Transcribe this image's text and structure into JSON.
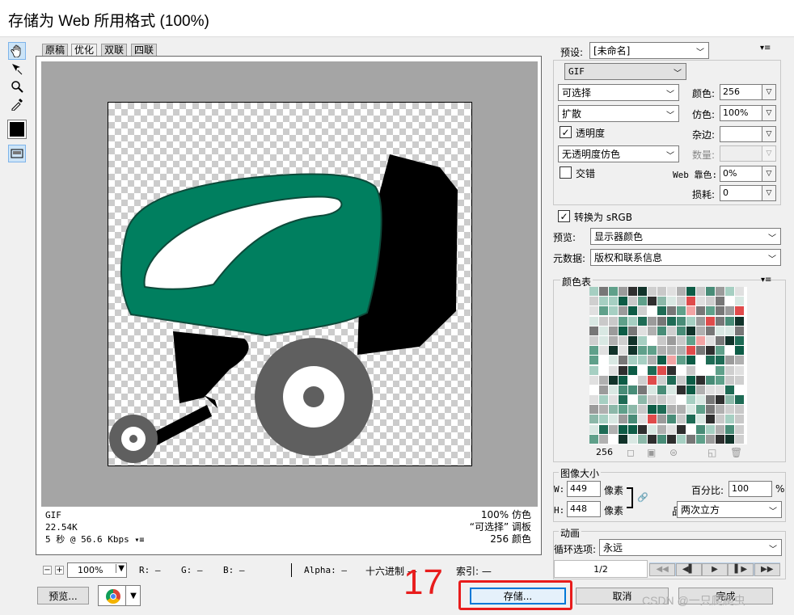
{
  "title": "存储为 Web 所用格式 (100%)",
  "tabs": [
    "原稿",
    "优化",
    "双联",
    "四联"
  ],
  "active_tab": 1,
  "info_left": [
    "GIF",
    "22.54K",
    "5 秒 @ 56.6 Kbps"
  ],
  "info_right": [
    "100% 仿色",
    "“可选择” 调板",
    "256 颜色"
  ],
  "statusbar": {
    "zoom": "100%",
    "r": "R: —",
    "g": "G: —",
    "b": "B: —",
    "alpha": "Alpha: —",
    "hex": "十六进制 —",
    "index": "索引: —"
  },
  "bottom": {
    "preview": "预览...",
    "save": "存储...",
    "cancel": "取消",
    "done": "完成",
    "annotation": "17",
    "watermark": "CSDN @一只爬爬虫"
  },
  "settings": {
    "preset_label": "预设:",
    "preset_value": "[未命名]",
    "format": "GIF",
    "reduction": "可选择",
    "dither_algo": "扩散",
    "colors_label": "颜色:",
    "colors_value": "256",
    "dither_label": "仿色:",
    "dither_value": "100%",
    "transparency": "透明度",
    "matte_label": "杂边:",
    "matte_value": "",
    "trans_dither": "无透明度仿色",
    "amount_label": "数量:",
    "amount_value": "",
    "interlaced": "交错",
    "websnap_label": "Web 靠色:",
    "websnap_value": "0%",
    "lossy_label": "损耗:",
    "lossy_value": "0",
    "srgb": "转换为 sRGB",
    "preview_label": "预览:",
    "preview_value": "显示器颜色",
    "meta_label": "元数据:",
    "meta_value": "版权和联系信息"
  },
  "color_table": {
    "title": "颜色表",
    "count": "256"
  },
  "image_size": {
    "title": "图像大小",
    "w_label": "W:",
    "w_value": "449",
    "h_label": "H:",
    "h_value": "448",
    "unit": "像素",
    "percent_label": "百分比:",
    "percent_value": "100",
    "percent_unit": "%",
    "quality_label": "品质:",
    "quality_value": "两次立方"
  },
  "animation": {
    "title": "动画",
    "loop_label": "循环选项:",
    "loop_value": "永远",
    "frame": "1/2"
  },
  "colors": {
    "accent_red": "#e81c1c",
    "truck_green": "#007f5f",
    "wheel_gray": "#5f5f5f"
  }
}
